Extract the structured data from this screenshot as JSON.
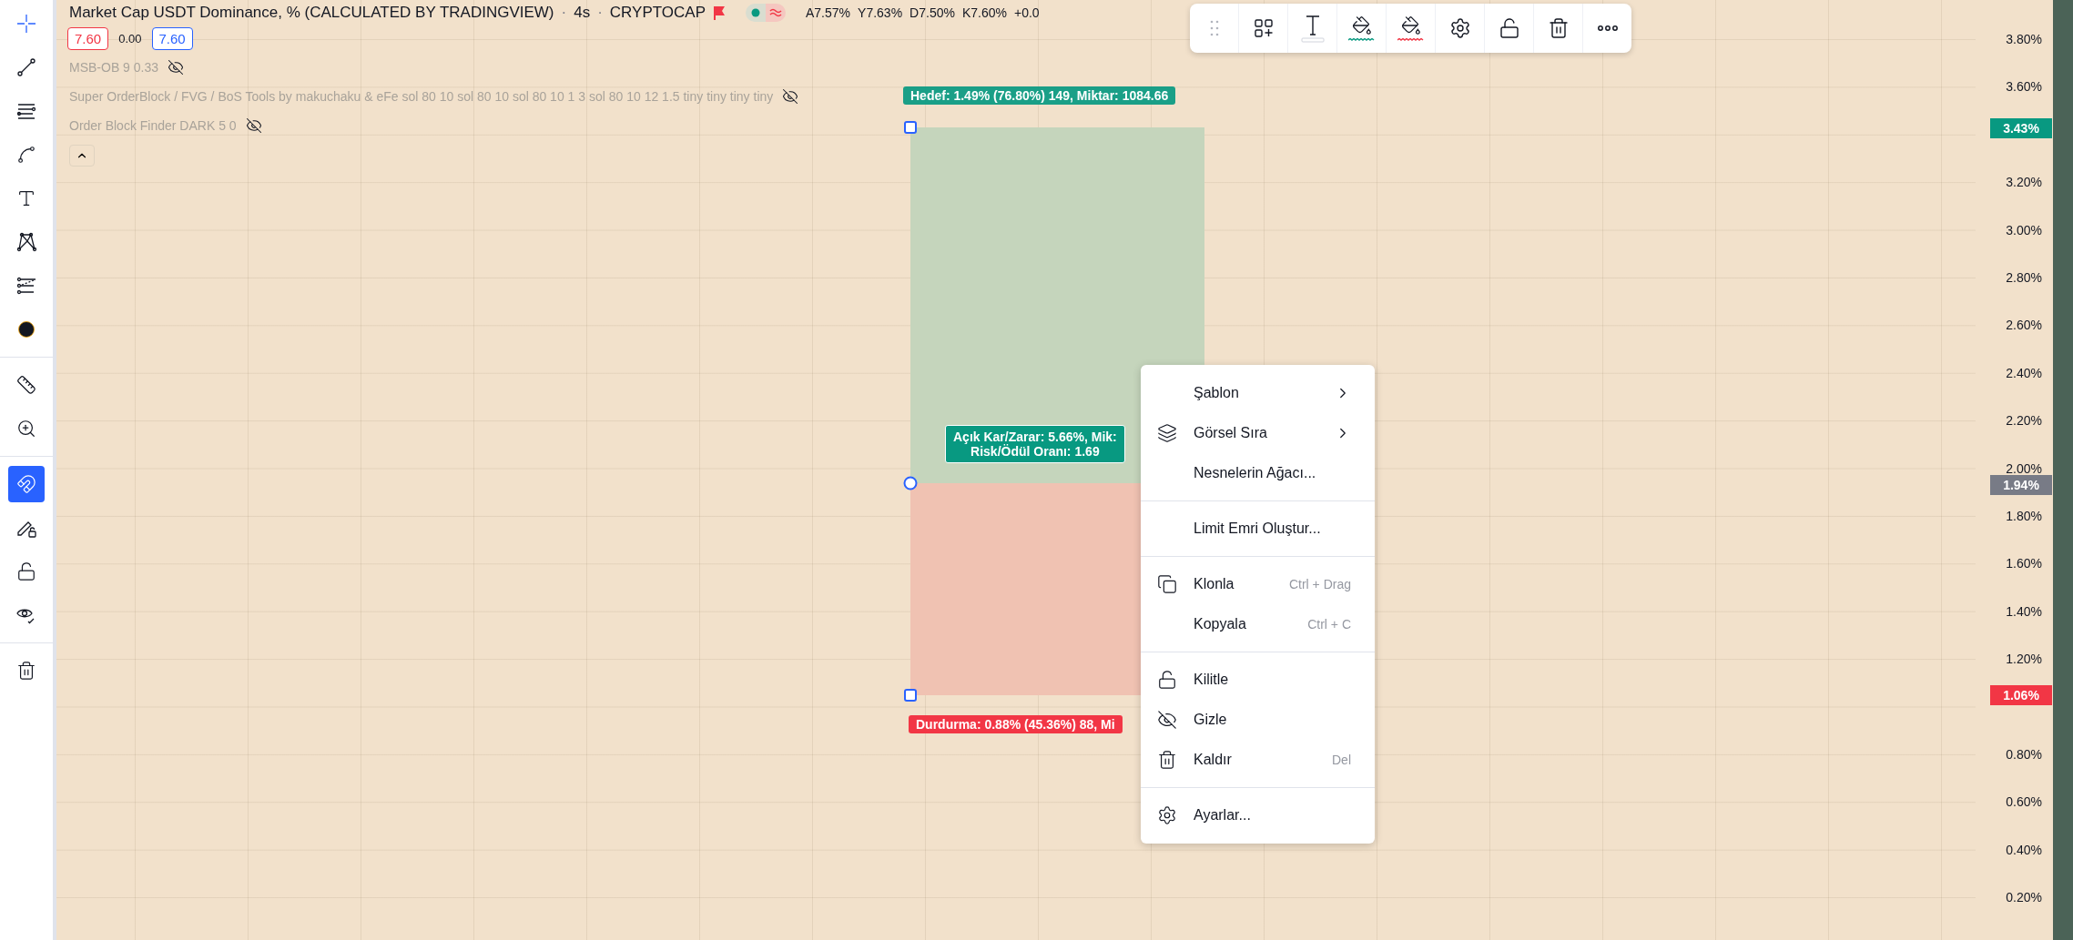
{
  "left_toolbar": [
    {
      "selected": true
    },
    {
      "selected": false
    },
    {
      "selected": false
    },
    {
      "selected": false
    },
    {
      "selected": false
    },
    {
      "selected": false
    },
    {
      "selected": false
    },
    {
      "selected": false
    },
    {
      "selected": false
    },
    {
      "selected": false
    },
    {
      "selected": true
    },
    {
      "selected": false
    },
    {
      "selected": false
    },
    {
      "selected": false
    },
    {
      "selected": false
    }
  ],
  "header": {
    "separator": "·",
    "title": "Market Cap USDT Dominance, % (CALCULATED BY TRADINGVIEW)",
    "interval": "4s",
    "exchange": "CRYPTOCAP",
    "ohlc": [
      "A7.57%",
      "Y7.63%",
      "D7.50%",
      "K7.60%",
      "+0.0"
    ]
  },
  "price_row": [
    {
      "kind": "sell",
      "text": "7.60"
    },
    {
      "kind": "spread",
      "text": "0.00"
    },
    {
      "kind": "buy",
      "text": "7.60"
    }
  ],
  "indicators": [
    {
      "label": "MSB-OB 9 0.33",
      "hidden": true
    },
    {
      "label": "Super OrderBlock / FVG / BoS Tools by makuchaku & eFe sol 80 10 sol 80 10 sol 80 10 1 3 sol 80 10 12 1.5 tiny tiny tiny tiny",
      "hidden": true
    },
    {
      "label": "Order Block Finder DARK 5 0",
      "hidden": true
    }
  ],
  "position": {
    "target_label": "Hedef: 1.49% (76.80%) 149, Miktar: 1084.66",
    "center_lines": [
      "Açık Kar/Zarar: 5.66%, Mik:",
      "Risk/Ödül Oranı: 1.69"
    ],
    "stop_label": "Durdurma: 0.88% (45.36%) 88, Mi"
  },
  "context_menu": [
    {
      "kind": "item",
      "label": "Şablon",
      "submenu": true
    },
    {
      "kind": "item",
      "label": "Görsel Sıra",
      "submenu": true
    },
    {
      "kind": "item",
      "label": "Nesnelerin Ağacı...",
      "submenu": false
    },
    {
      "kind": "separator"
    },
    {
      "kind": "item",
      "label": "Limit Emri Oluştur...",
      "submenu": false
    },
    {
      "kind": "separator"
    },
    {
      "kind": "item",
      "label": "Klonla",
      "shortcut": "Ctrl + Drag",
      "submenu": false
    },
    {
      "kind": "item",
      "label": "Kopyala",
      "shortcut": "Ctrl + C",
      "submenu": false
    },
    {
      "kind": "separator"
    },
    {
      "kind": "item",
      "label": "Kilitle",
      "submenu": false
    },
    {
      "kind": "item",
      "label": "Gizle",
      "submenu": false
    },
    {
      "kind": "item",
      "label": "Kaldır",
      "shortcut": "Del",
      "submenu": false
    },
    {
      "kind": "separator"
    },
    {
      "kind": "item",
      "label": "Ayarlar...",
      "submenu": false
    }
  ],
  "price_axis": {
    "ticks": [
      "3.80%",
      "3.60%",
      "3.20%",
      "3.00%",
      "2.80%",
      "2.60%",
      "2.40%",
      "2.20%",
      "2.00%",
      "1.80%",
      "1.60%",
      "1.40%",
      "1.20%",
      "0.80%",
      "0.60%",
      "0.40%",
      "0.20%"
    ],
    "badges": [
      {
        "text": "3.43%",
        "color": "#089981"
      },
      {
        "text": "1.94%",
        "color": "#787b86"
      },
      {
        "text": "1.06%",
        "color": "#f23645"
      }
    ]
  }
}
